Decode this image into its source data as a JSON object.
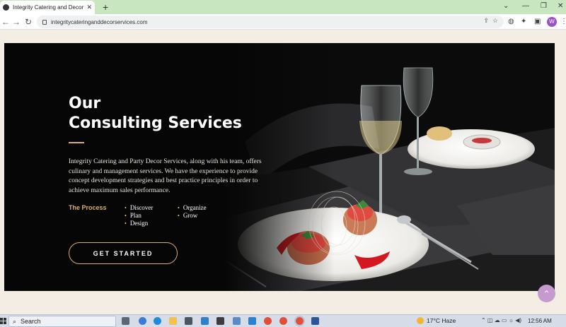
{
  "browser": {
    "tab_title": "Integrity Catering and Decor Se",
    "tab_close": "✕",
    "new_tab": "+",
    "url": "integritycateringanddecorservices.com",
    "profile_initial": "W",
    "win_min": "—",
    "win_restore": "❐",
    "win_close": "✕",
    "win_dropdown": "⌄"
  },
  "hero": {
    "title_line1": "Our",
    "title_line2": "Consulting Services",
    "description": "Integrity Catering and Party Decor Services, along with his team, offers culinary and management services. We have the experience to provide concept development strategies and best practice principles in order to achieve maximum sales performance.",
    "process_label": "The Process",
    "process_col1": [
      "Discover",
      "Plan",
      "Design"
    ],
    "process_col2": [
      "Organize",
      "Grow"
    ],
    "cta_label": "GET STARTED",
    "accent_color": "#d9b06e"
  },
  "taskbar": {
    "search_label": "Search",
    "weather": "17°C  Haze",
    "time": "12:56 AM"
  }
}
